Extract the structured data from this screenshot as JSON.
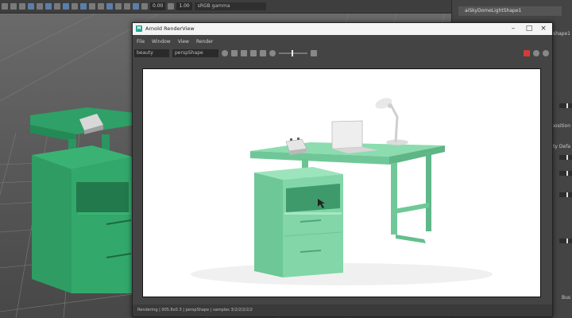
{
  "main_toolbar": {
    "field_a": "0.00",
    "field_b": "1.00",
    "colorspace": "sRGB gamma"
  },
  "right_panel": {
    "tab_label": "aiSkyDomeLightShape1",
    "fragments": [
      "lshape1",
      "omposition",
      "ty Defa",
      "Bus"
    ]
  },
  "render_view": {
    "title": "Arnold RenderView",
    "menu": [
      "File",
      "Window",
      "View",
      "Render"
    ],
    "aov": "beauty",
    "camera": "perspShape",
    "status": "Rendering | 905.8x0.3 | perspShape | samples 3/2/2/2/2/2"
  },
  "colors": {
    "desk_green": "#7fd4a4",
    "viewport_green": "#2d9660",
    "accent": "#21a593"
  }
}
